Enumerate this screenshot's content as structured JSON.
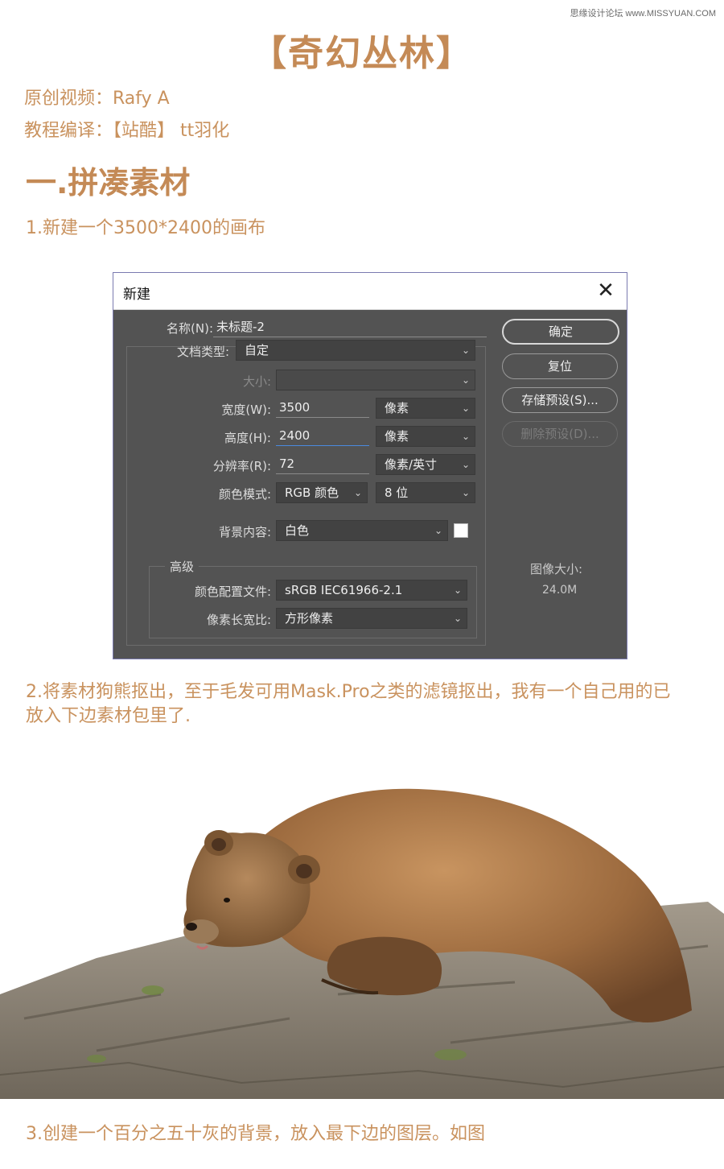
{
  "watermark": "思缘设计论坛 www.MISSYUAN.COM",
  "title": "【奇幻丛林】",
  "credits": {
    "original_video": "原创视频：Rafy A",
    "translation": "教程编译：【站酷】 tt羽化"
  },
  "section_heading": "一.拼凑素材",
  "steps": {
    "step1": "1.新建一个3500*2400的画布",
    "step2_line1": "2.将素材狗熊抠出，至于毛发可用Mask.Pro之类的滤镜抠出，我有一个自己用的已",
    "step2_line2": "放入下边素材包里了.",
    "step3": "3.创建一个百分之五十灰的背景，放入最下边的图层。如图"
  },
  "dialog": {
    "title": "新建",
    "close_glyph": "✕",
    "name_label": "名称(N):",
    "name_value": "未标题-2",
    "doc_type_label": "文档类型:",
    "doc_type_value": "自定",
    "size_label": "大小:",
    "size_value": "",
    "width_label": "宽度(W):",
    "width_value": "3500",
    "width_unit": "像素",
    "height_label": "高度(H):",
    "height_value": "2400",
    "height_unit": "像素",
    "resolution_label": "分辨率(R):",
    "resolution_value": "72",
    "resolution_unit": "像素/英寸",
    "color_mode_label": "颜色模式:",
    "color_mode_value": "RGB 颜色",
    "bit_depth_value": "8 位",
    "background_label": "背景内容:",
    "background_value": "白色",
    "advanced_label": "高级",
    "color_profile_label": "颜色配置文件:",
    "color_profile_value": "sRGB IEC61966-2.1",
    "pixel_aspect_label": "像素长宽比:",
    "pixel_aspect_value": "方形像素",
    "buttons": {
      "ok": "确定",
      "reset": "复位",
      "save_preset": "存储预设(S)...",
      "delete_preset": "删除预设(D)..."
    },
    "image_size_label": "图像大小:",
    "image_size_value": "24.0M",
    "chevron_glyph": "⌄"
  },
  "colors": {
    "heading": "#c48a56",
    "dialog_bg": "#535353",
    "titlebar_bg": "#ffffff"
  }
}
